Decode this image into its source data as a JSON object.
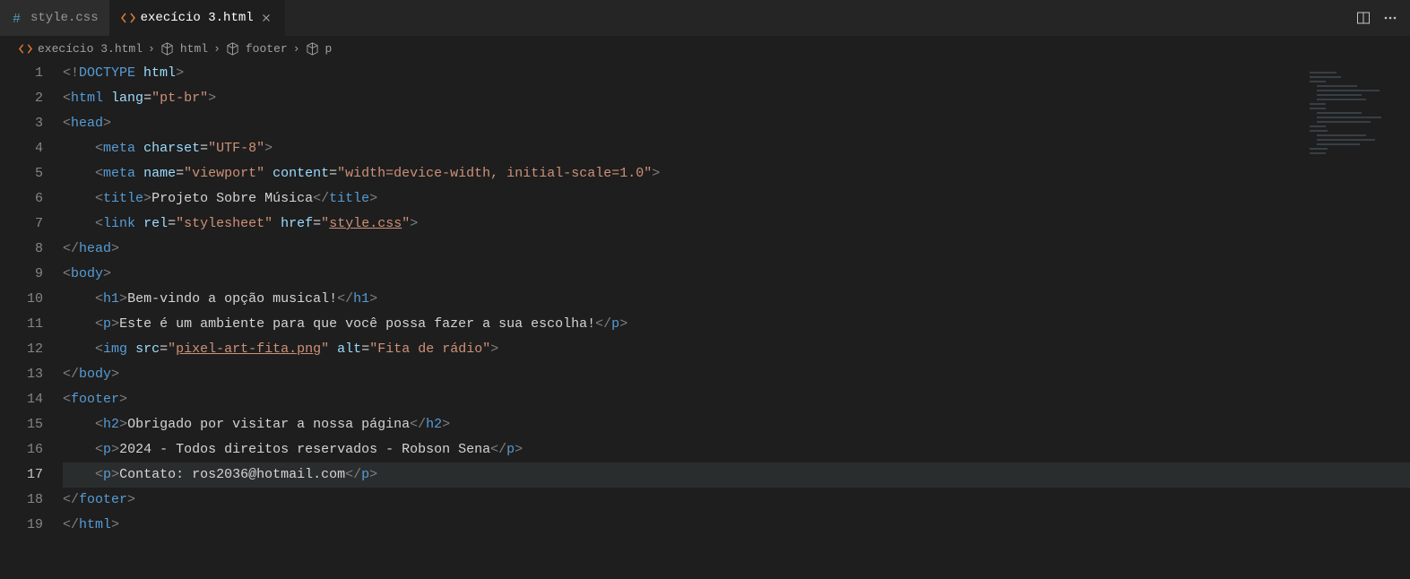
{
  "tabs": [
    {
      "icon": "hash",
      "label": "style.css",
      "active": false,
      "close": false
    },
    {
      "icon": "code",
      "label": "execício 3.html",
      "active": true,
      "close": true
    }
  ],
  "breadcrumbs": {
    "items": [
      {
        "icon": "code",
        "label": "execício 3.html"
      },
      {
        "icon": "cube",
        "label": "html"
      },
      {
        "icon": "cube",
        "label": "footer"
      },
      {
        "icon": "cube",
        "label": "p"
      }
    ]
  },
  "lines": {
    "count": 19,
    "current": 17
  },
  "code": {
    "l1": {
      "doctype": "DOCTYPE",
      "html": "html"
    },
    "l2": {
      "tag": "html",
      "attr": "lang",
      "val": "\"pt-br\""
    },
    "l3": {
      "tag": "head"
    },
    "l4": {
      "tag": "meta",
      "attr": "charset",
      "val": "\"UTF-8\""
    },
    "l5": {
      "tag": "meta",
      "attr1": "name",
      "val1": "\"viewport\"",
      "attr2": "content",
      "val2": "\"width=device-width, initial-scale=1.0\""
    },
    "l6": {
      "tag": "title",
      "text": "Projeto Sobre Música"
    },
    "l7": {
      "tag": "link",
      "attr1": "rel",
      "val1": "\"stylesheet\"",
      "attr2": "href",
      "val2_pre": "\"",
      "val2_link": "style.css",
      "val2_post": "\""
    },
    "l8": {
      "tag": "head"
    },
    "l9": {
      "tag": "body"
    },
    "l10": {
      "tag": "h1",
      "text": "Bem-vindo a opção musical!"
    },
    "l11": {
      "tag": "p",
      "text": "Este é um ambiente para que você possa fazer a sua escolha!"
    },
    "l12": {
      "tag": "img",
      "attr1": "src",
      "val1_pre": "\"",
      "val1_link": "pixel-art-fita.png",
      "val1_post": "\"",
      "attr2": "alt",
      "val2": "\"Fita de rádio\""
    },
    "l13": {
      "tag": "body"
    },
    "l14": {
      "tag": "footer"
    },
    "l15": {
      "tag": "h2",
      "text": "Obrigado por visitar a nossa página"
    },
    "l16": {
      "tag": "p",
      "text": "2024 - Todos direitos reservados - Robson Sena"
    },
    "l17": {
      "tag": "p",
      "text": "Contato: ros2036@hotmail.com"
    },
    "l18": {
      "tag": "footer"
    },
    "l19": {
      "tag": "html"
    }
  }
}
